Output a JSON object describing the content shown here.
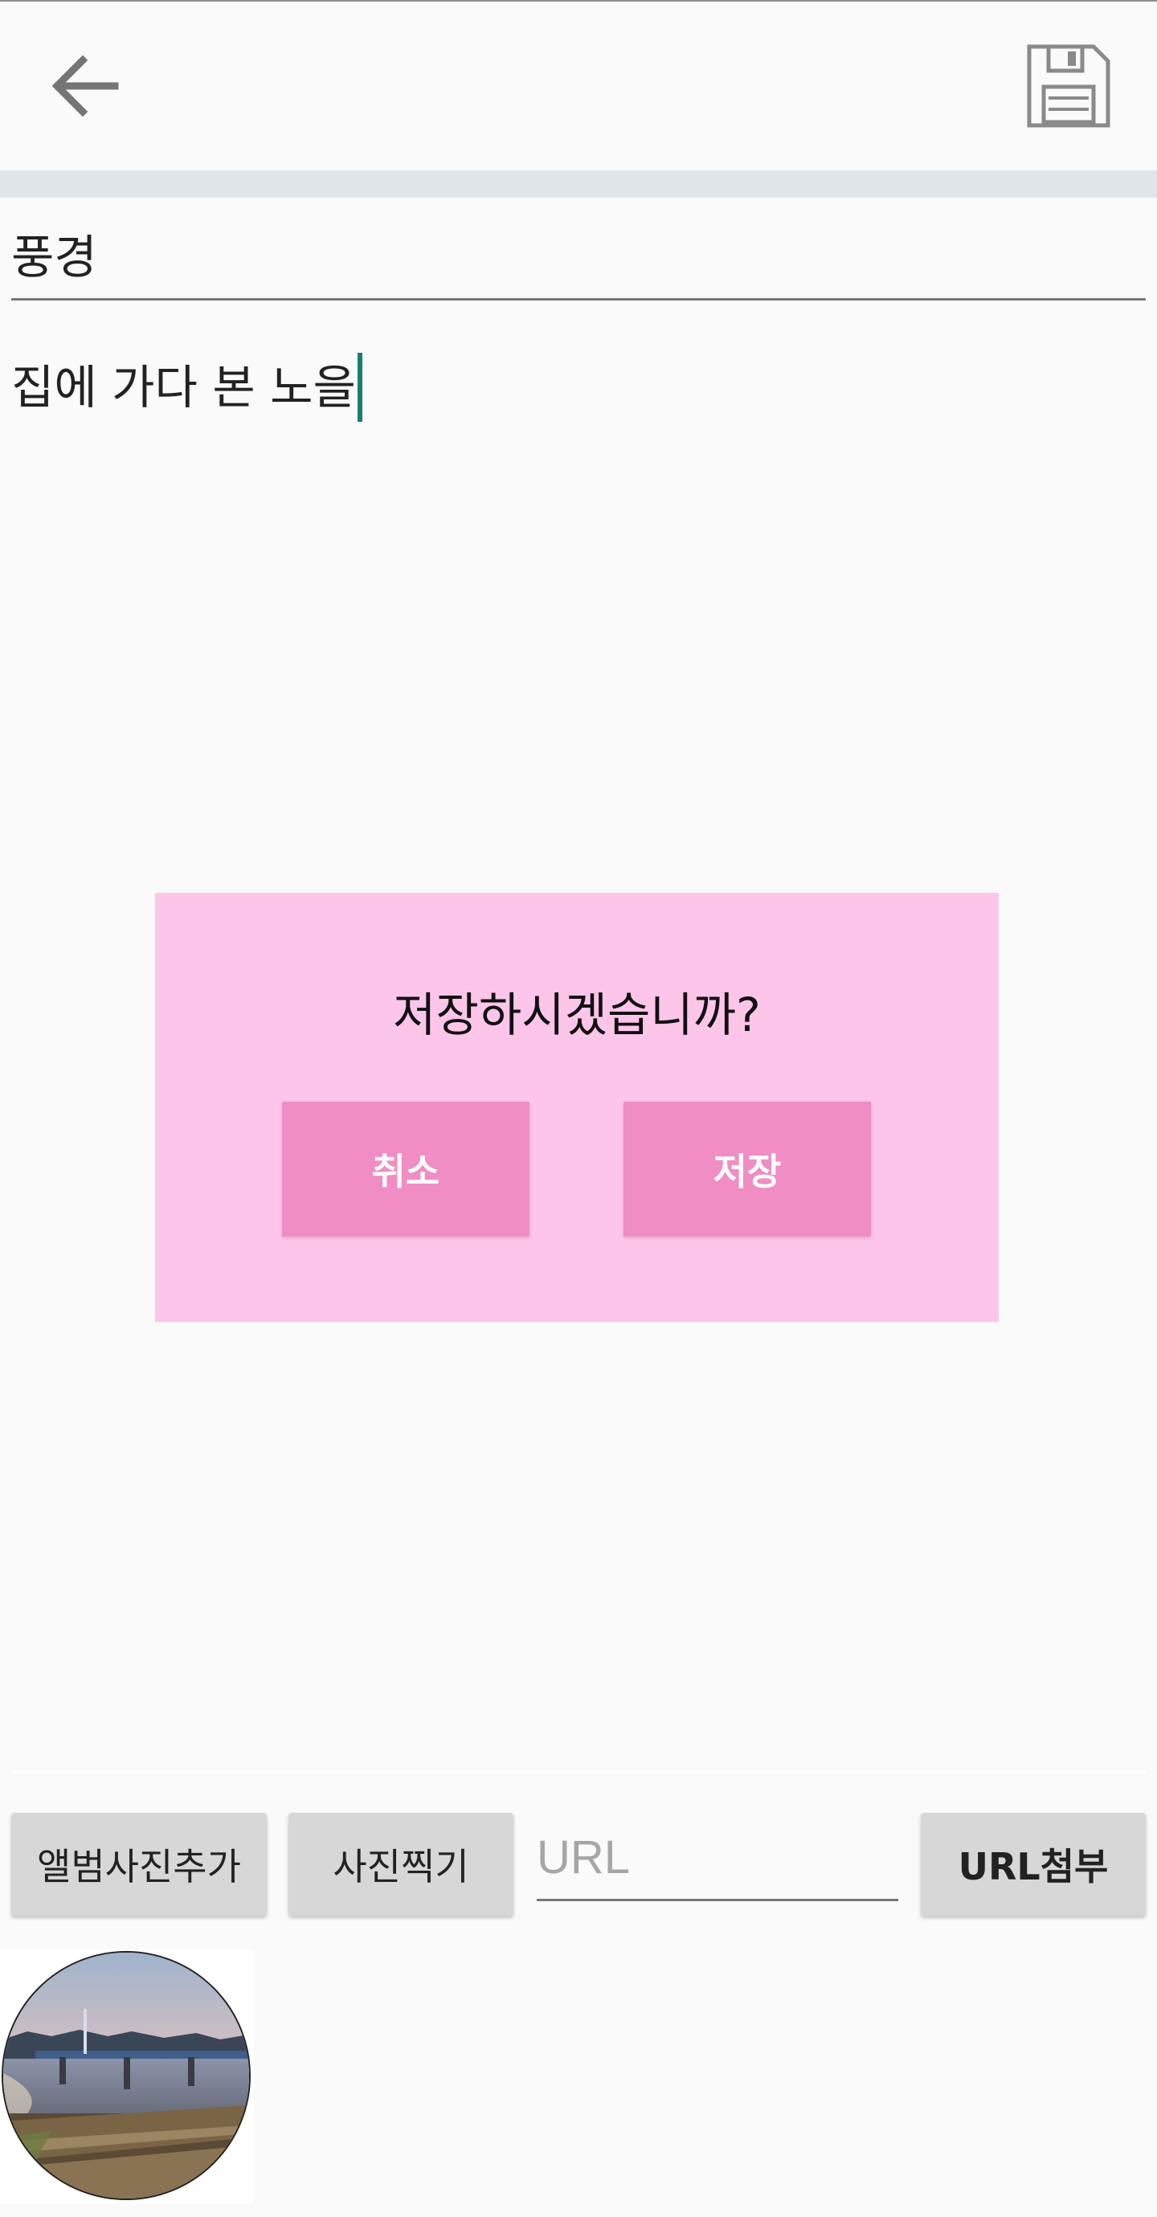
{
  "toolbar": {
    "back_icon": "arrow-left-icon",
    "save_icon": "floppy-disk-icon"
  },
  "note": {
    "title": "풍경",
    "body": "집에 가다 본 노을"
  },
  "dialog": {
    "message": "저장하시겠습니까?",
    "cancel_label": "취소",
    "confirm_label": "저장"
  },
  "actions": {
    "album_label": "앨범사진추가",
    "camera_label": "사진찍기",
    "url_placeholder": "URL",
    "url_attach_label": "URL첨부"
  },
  "colors": {
    "dialog_bg": "#fdc5e9",
    "dialog_button": "#f08dc4",
    "caret": "#1b7e6f",
    "header_band": "#e1e6e8"
  }
}
